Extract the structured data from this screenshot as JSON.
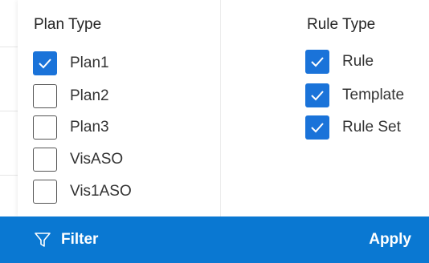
{
  "colors": {
    "accent": "#1a73d9",
    "footer_bg": "#0a78d2",
    "footer_text": "#ffffff"
  },
  "plan_type": {
    "title": "Plan Type",
    "options": [
      {
        "label": "Plan1",
        "checked": true
      },
      {
        "label": "Plan2",
        "checked": false
      },
      {
        "label": "Plan3",
        "checked": false
      },
      {
        "label": "VisASO",
        "checked": false
      },
      {
        "label": "Vis1ASO",
        "checked": false
      }
    ]
  },
  "rule_type": {
    "title": "Rule Type",
    "options": [
      {
        "label": "Rule",
        "checked": true
      },
      {
        "label": "Template",
        "checked": true
      },
      {
        "label": "Rule Set",
        "checked": true
      }
    ]
  },
  "footer": {
    "filter_icon": "filter-funnel-icon",
    "filter_label": "Filter",
    "apply_label": "Apply"
  }
}
